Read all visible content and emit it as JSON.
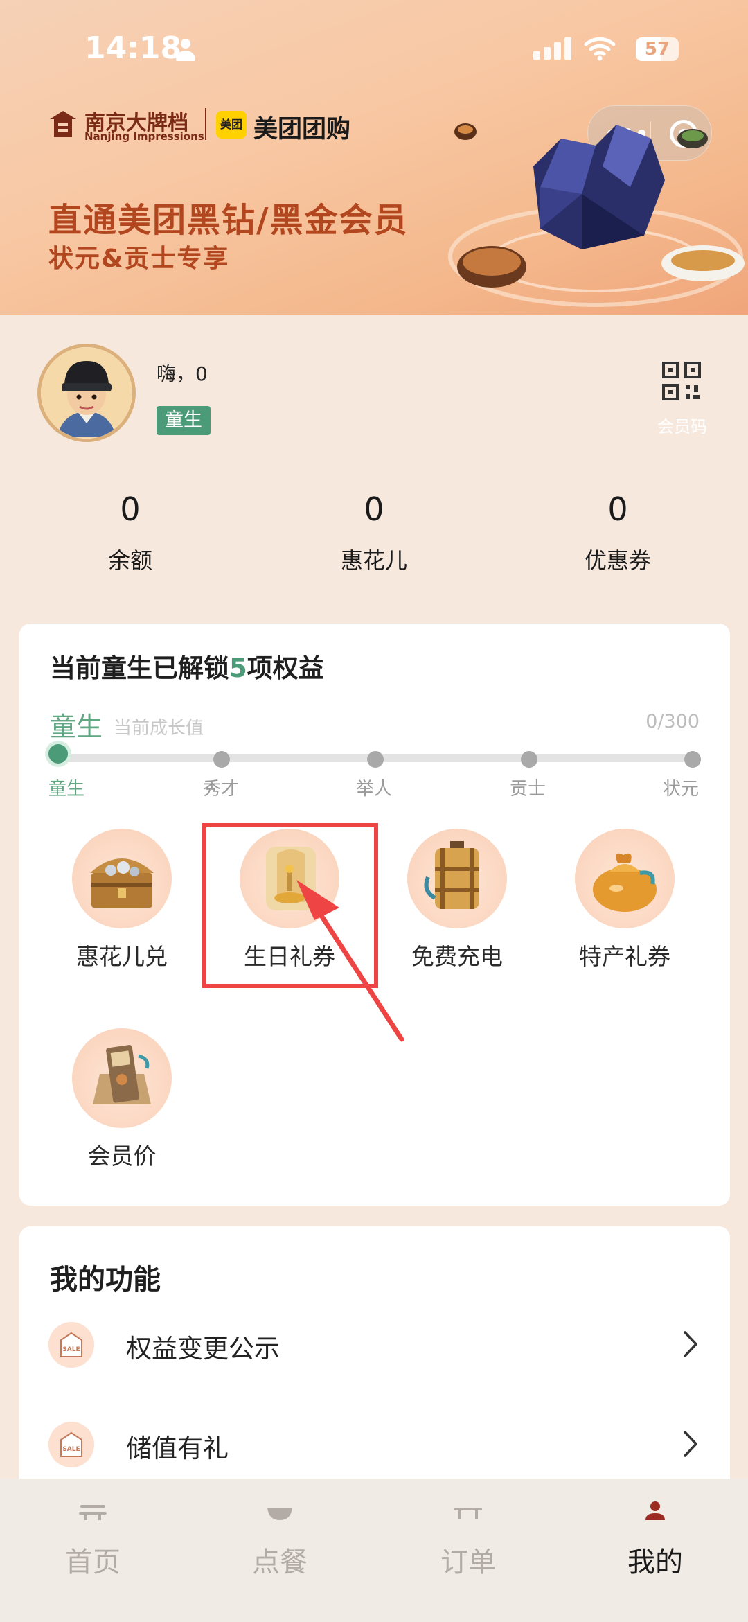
{
  "status_bar": {
    "time": "14:18",
    "battery": "57"
  },
  "banner": {
    "brand_cn": "南京大牌档",
    "brand_en": "Nanjing Impressions",
    "meituan_badge": "美团",
    "meituan_text": "美团团购",
    "title": "直通美团黑钻/黑金会员",
    "subtitle": "状元&贡士专享"
  },
  "profile": {
    "greeting": "嗨，0",
    "level": "童生",
    "qr_label": "会员码"
  },
  "stats": [
    {
      "value": "0",
      "label": "余额"
    },
    {
      "value": "0",
      "label": "惠花儿"
    },
    {
      "value": "0",
      "label": "优惠券"
    }
  ],
  "benefits": {
    "title_prefix": "当前童生已解锁",
    "title_count": "5",
    "title_suffix": "项权益",
    "current_level": "童生",
    "current_hint": "当前成长值",
    "growth": "0/300",
    "progress": 0.0,
    "levels": [
      "童生",
      "秀才",
      "举人",
      "贡士",
      "状元"
    ],
    "items": [
      {
        "label": "惠花儿兑",
        "icon": "treasure-chest-icon"
      },
      {
        "label": "生日礼券",
        "icon": "birthday-scroll-icon"
      },
      {
        "label": "免费充电",
        "icon": "lantern-charge-icon"
      },
      {
        "label": "特产礼券",
        "icon": "gift-bag-icon"
      },
      {
        "label": "会员价",
        "icon": "member-price-icon"
      }
    ]
  },
  "functions": {
    "title": "我的功能",
    "items": [
      {
        "label": "权益变更公示",
        "icon": "sale-tag-icon",
        "icon_text": "SALE"
      },
      {
        "label": "储值有礼",
        "icon": "sale-tag-icon",
        "icon_text": "SALE"
      }
    ]
  },
  "tabbar": {
    "items": [
      {
        "label": "首页",
        "icon": "home-icon",
        "active": false
      },
      {
        "label": "点餐",
        "icon": "bowl-icon",
        "active": false
      },
      {
        "label": "订单",
        "icon": "order-icon",
        "active": false
      },
      {
        "label": "我的",
        "icon": "profile-icon",
        "active": true
      }
    ]
  },
  "colors": {
    "accent_green": "#4b9a78",
    "banner_text": "#b2461f",
    "highlight_red": "#ee4444"
  }
}
